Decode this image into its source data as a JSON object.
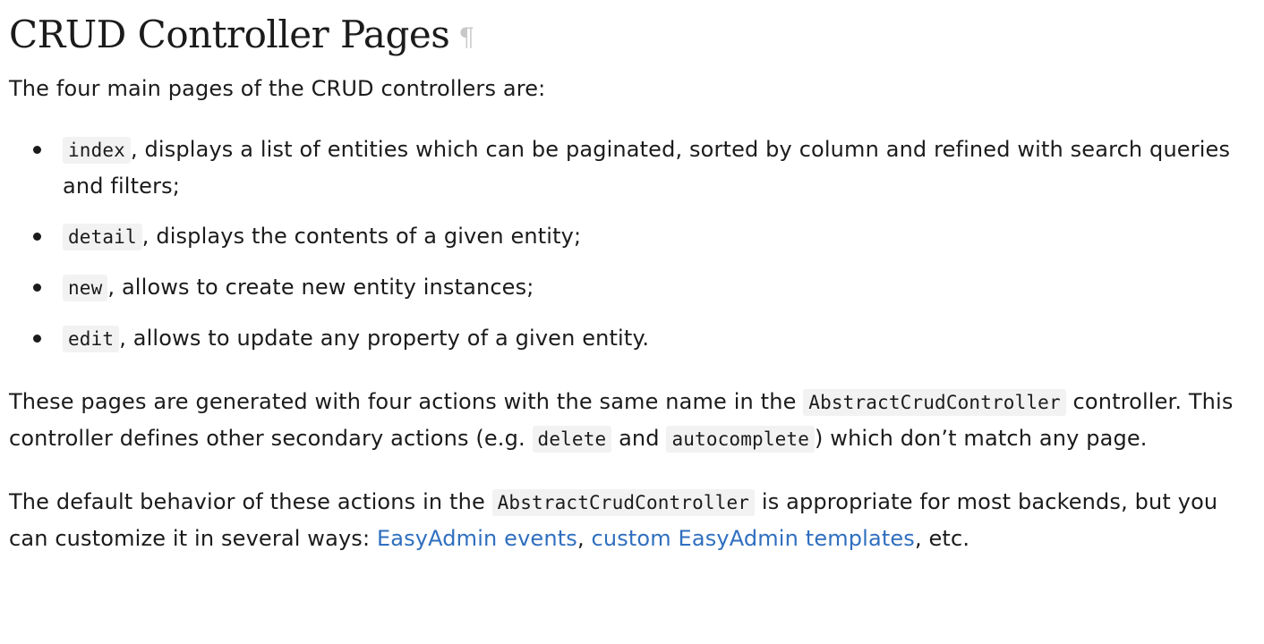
{
  "heading": {
    "title": "CRUD Controller Pages",
    "anchor_symbol": "¶"
  },
  "intro": "The four main pages of the CRUD controllers are:",
  "pages_list": [
    {
      "code": "index",
      "text": ", displays a list of entities which can be paginated, sorted by column and refined with search queries and filters;"
    },
    {
      "code": "detail",
      "text": ", displays the contents of a given entity;"
    },
    {
      "code": "new",
      "text": ", allows to create new entity instances;"
    },
    {
      "code": "edit",
      "text": ", allows to update any property of a given entity."
    }
  ],
  "paragraph2": {
    "part1": "These pages are generated with four actions with the same name in the ",
    "code1": "AbstractCrudController",
    "part2": " controller. This controller defines other secondary actions (e.g. ",
    "code2": "delete",
    "part3": " and ",
    "code3": "autocomplete",
    "part4": ") which don’t match any page."
  },
  "paragraph3": {
    "part1": "The default behavior of these actions in the ",
    "code1": "AbstractCrudController",
    "part2": " is appropriate for most backends, but you can customize it in several ways: ",
    "link1": "EasyAdmin events",
    "sep": ", ",
    "link2": "custom EasyAdmin templates",
    "part3": ", etc."
  },
  "colors": {
    "text": "#1b1b1b",
    "link": "#2f6fbf",
    "code_background": "#f2f2f2",
    "pilcrow": "#c8c8c8"
  }
}
